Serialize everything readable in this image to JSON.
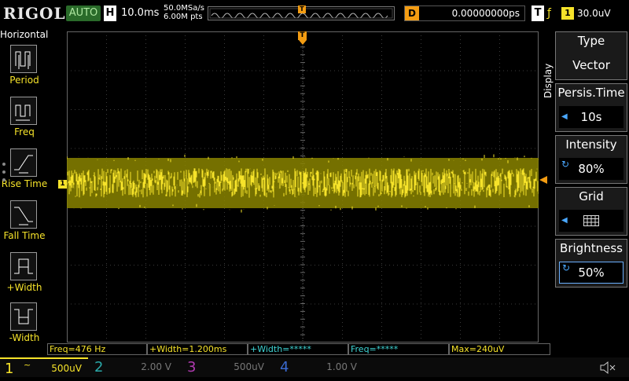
{
  "top": {
    "brand": "RIGOL",
    "run_state": "AUTO",
    "timebase_letter": "H",
    "timebase": "10.0ms",
    "sample_rate": "50.0MSa/s",
    "memory_depth": "6.00M pts",
    "trigger_pos_marker": "T",
    "delay_letter": "D",
    "delay": "0.00000000ps",
    "trigger_letter": "T",
    "trigger_edge": "ƒ",
    "trigger_source": "1",
    "trigger_level": "30.0uV"
  },
  "left_panel": {
    "title": "Horizontal",
    "items": [
      {
        "label": "Period",
        "icon": "period-icon"
      },
      {
        "label": "Freq",
        "icon": "freq-icon"
      },
      {
        "label": "Rise Time",
        "icon": "rise-time-icon"
      },
      {
        "label": "Fall Time",
        "icon": "fall-time-icon"
      },
      {
        "label": "+Width",
        "icon": "pos-width-icon"
      },
      {
        "label": "-Width",
        "icon": "neg-width-icon"
      }
    ]
  },
  "screen": {
    "ch1_marker": "1",
    "trigger_marker": "T",
    "trace_color": "#f6e32a",
    "trace_dim_color": "#8a8400"
  },
  "right_menu": {
    "tab_label": "Display",
    "items": [
      {
        "title": "Type",
        "value": "Vector",
        "control": "none"
      },
      {
        "title": "Persis.Time",
        "value": "10s",
        "control": "arrow"
      },
      {
        "title": "Intensity",
        "value": "80%",
        "control": "knob"
      },
      {
        "title": "Grid",
        "value": "",
        "control": "arrow"
      },
      {
        "title": "Brightness",
        "value": "50%",
        "control": "knob"
      }
    ]
  },
  "measurements": [
    {
      "text": "Freq=476 Hz",
      "color": "#f6e32a"
    },
    {
      "text": "+Width=1.200ms",
      "color": "#f6e32a"
    },
    {
      "text": "+Width=*****",
      "color": "#3fd6d6"
    },
    {
      "text": "Freq=*****",
      "color": "#3fd6d6"
    },
    {
      "text": "Max=240uV",
      "color": "#f6e32a"
    }
  ],
  "channels": [
    {
      "num": "1",
      "coupling": "~",
      "scale": "500uV",
      "color": "#f6e32a",
      "active": true
    },
    {
      "num": "2",
      "coupling": "",
      "scale": "2.00 V",
      "color": "#2aa9a9",
      "active": false
    },
    {
      "num": "3",
      "coupling": "",
      "scale": "500uV",
      "color": "#b03ab0",
      "active": false
    },
    {
      "num": "4",
      "coupling": "",
      "scale": "1.00 V",
      "color": "#3a6ad0",
      "active": false
    }
  ],
  "speaker_icon": "speaker-mute-icon"
}
